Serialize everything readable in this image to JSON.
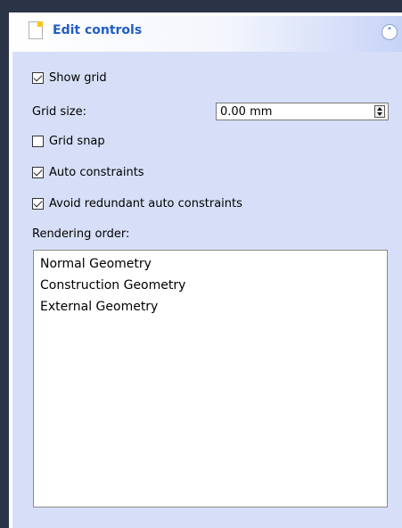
{
  "panel": {
    "title": "Edit controls",
    "collapse_glyph": "˄"
  },
  "controls": {
    "show_grid": {
      "label": "Show grid",
      "checked": true
    },
    "grid_size": {
      "label": "Grid size:",
      "value": "0.00 mm"
    },
    "grid_snap": {
      "label": "Grid snap",
      "checked": false
    },
    "auto_constraints": {
      "label": "Auto constraints",
      "checked": true
    },
    "avoid_redundant": {
      "label": "Avoid redundant auto constraints",
      "checked": true
    }
  },
  "rendering_order": {
    "label": "Rendering order:",
    "items": [
      "Normal Geometry",
      "Construction Geometry",
      "External Geometry"
    ]
  },
  "icons": {
    "panel_icon": "document-icon",
    "collapse_icon": "chevron-up-icon"
  },
  "colors": {
    "title": "#215dc6",
    "panel_bg": "#d6dff7",
    "frame": "#2b3347"
  }
}
